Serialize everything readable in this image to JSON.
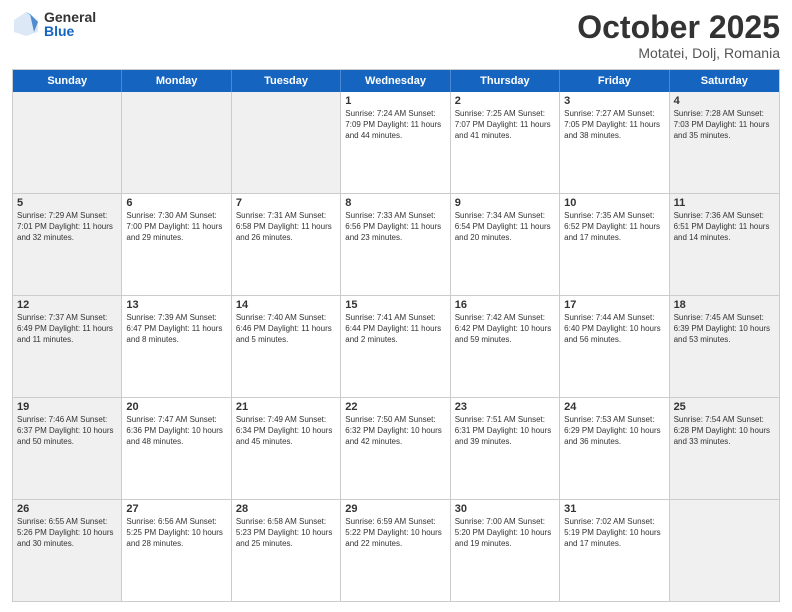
{
  "logo": {
    "general": "General",
    "blue": "Blue"
  },
  "header": {
    "month": "October 2025",
    "location": "Motatei, Dolj, Romania"
  },
  "days": [
    "Sunday",
    "Monday",
    "Tuesday",
    "Wednesday",
    "Thursday",
    "Friday",
    "Saturday"
  ],
  "weeks": [
    [
      {
        "day": "",
        "info": "",
        "shaded": true
      },
      {
        "day": "",
        "info": "",
        "shaded": true
      },
      {
        "day": "",
        "info": "",
        "shaded": true
      },
      {
        "day": "1",
        "info": "Sunrise: 7:24 AM\nSunset: 7:09 PM\nDaylight: 11 hours and 44 minutes.",
        "shaded": false
      },
      {
        "day": "2",
        "info": "Sunrise: 7:25 AM\nSunset: 7:07 PM\nDaylight: 11 hours and 41 minutes.",
        "shaded": false
      },
      {
        "day": "3",
        "info": "Sunrise: 7:27 AM\nSunset: 7:05 PM\nDaylight: 11 hours and 38 minutes.",
        "shaded": false
      },
      {
        "day": "4",
        "info": "Sunrise: 7:28 AM\nSunset: 7:03 PM\nDaylight: 11 hours and 35 minutes.",
        "shaded": true
      }
    ],
    [
      {
        "day": "5",
        "info": "Sunrise: 7:29 AM\nSunset: 7:01 PM\nDaylight: 11 hours and 32 minutes.",
        "shaded": true
      },
      {
        "day": "6",
        "info": "Sunrise: 7:30 AM\nSunset: 7:00 PM\nDaylight: 11 hours and 29 minutes.",
        "shaded": false
      },
      {
        "day": "7",
        "info": "Sunrise: 7:31 AM\nSunset: 6:58 PM\nDaylight: 11 hours and 26 minutes.",
        "shaded": false
      },
      {
        "day": "8",
        "info": "Sunrise: 7:33 AM\nSunset: 6:56 PM\nDaylight: 11 hours and 23 minutes.",
        "shaded": false
      },
      {
        "day": "9",
        "info": "Sunrise: 7:34 AM\nSunset: 6:54 PM\nDaylight: 11 hours and 20 minutes.",
        "shaded": false
      },
      {
        "day": "10",
        "info": "Sunrise: 7:35 AM\nSunset: 6:52 PM\nDaylight: 11 hours and 17 minutes.",
        "shaded": false
      },
      {
        "day": "11",
        "info": "Sunrise: 7:36 AM\nSunset: 6:51 PM\nDaylight: 11 hours and 14 minutes.",
        "shaded": true
      }
    ],
    [
      {
        "day": "12",
        "info": "Sunrise: 7:37 AM\nSunset: 6:49 PM\nDaylight: 11 hours and 11 minutes.",
        "shaded": true
      },
      {
        "day": "13",
        "info": "Sunrise: 7:39 AM\nSunset: 6:47 PM\nDaylight: 11 hours and 8 minutes.",
        "shaded": false
      },
      {
        "day": "14",
        "info": "Sunrise: 7:40 AM\nSunset: 6:46 PM\nDaylight: 11 hours and 5 minutes.",
        "shaded": false
      },
      {
        "day": "15",
        "info": "Sunrise: 7:41 AM\nSunset: 6:44 PM\nDaylight: 11 hours and 2 minutes.",
        "shaded": false
      },
      {
        "day": "16",
        "info": "Sunrise: 7:42 AM\nSunset: 6:42 PM\nDaylight: 10 hours and 59 minutes.",
        "shaded": false
      },
      {
        "day": "17",
        "info": "Sunrise: 7:44 AM\nSunset: 6:40 PM\nDaylight: 10 hours and 56 minutes.",
        "shaded": false
      },
      {
        "day": "18",
        "info": "Sunrise: 7:45 AM\nSunset: 6:39 PM\nDaylight: 10 hours and 53 minutes.",
        "shaded": true
      }
    ],
    [
      {
        "day": "19",
        "info": "Sunrise: 7:46 AM\nSunset: 6:37 PM\nDaylight: 10 hours and 50 minutes.",
        "shaded": true
      },
      {
        "day": "20",
        "info": "Sunrise: 7:47 AM\nSunset: 6:36 PM\nDaylight: 10 hours and 48 minutes.",
        "shaded": false
      },
      {
        "day": "21",
        "info": "Sunrise: 7:49 AM\nSunset: 6:34 PM\nDaylight: 10 hours and 45 minutes.",
        "shaded": false
      },
      {
        "day": "22",
        "info": "Sunrise: 7:50 AM\nSunset: 6:32 PM\nDaylight: 10 hours and 42 minutes.",
        "shaded": false
      },
      {
        "day": "23",
        "info": "Sunrise: 7:51 AM\nSunset: 6:31 PM\nDaylight: 10 hours and 39 minutes.",
        "shaded": false
      },
      {
        "day": "24",
        "info": "Sunrise: 7:53 AM\nSunset: 6:29 PM\nDaylight: 10 hours and 36 minutes.",
        "shaded": false
      },
      {
        "day": "25",
        "info": "Sunrise: 7:54 AM\nSunset: 6:28 PM\nDaylight: 10 hours and 33 minutes.",
        "shaded": true
      }
    ],
    [
      {
        "day": "26",
        "info": "Sunrise: 6:55 AM\nSunset: 5:26 PM\nDaylight: 10 hours and 30 minutes.",
        "shaded": true
      },
      {
        "day": "27",
        "info": "Sunrise: 6:56 AM\nSunset: 5:25 PM\nDaylight: 10 hours and 28 minutes.",
        "shaded": false
      },
      {
        "day": "28",
        "info": "Sunrise: 6:58 AM\nSunset: 5:23 PM\nDaylight: 10 hours and 25 minutes.",
        "shaded": false
      },
      {
        "day": "29",
        "info": "Sunrise: 6:59 AM\nSunset: 5:22 PM\nDaylight: 10 hours and 22 minutes.",
        "shaded": false
      },
      {
        "day": "30",
        "info": "Sunrise: 7:00 AM\nSunset: 5:20 PM\nDaylight: 10 hours and 19 minutes.",
        "shaded": false
      },
      {
        "day": "31",
        "info": "Sunrise: 7:02 AM\nSunset: 5:19 PM\nDaylight: 10 hours and 17 minutes.",
        "shaded": false
      },
      {
        "day": "",
        "info": "",
        "shaded": true
      }
    ]
  ]
}
